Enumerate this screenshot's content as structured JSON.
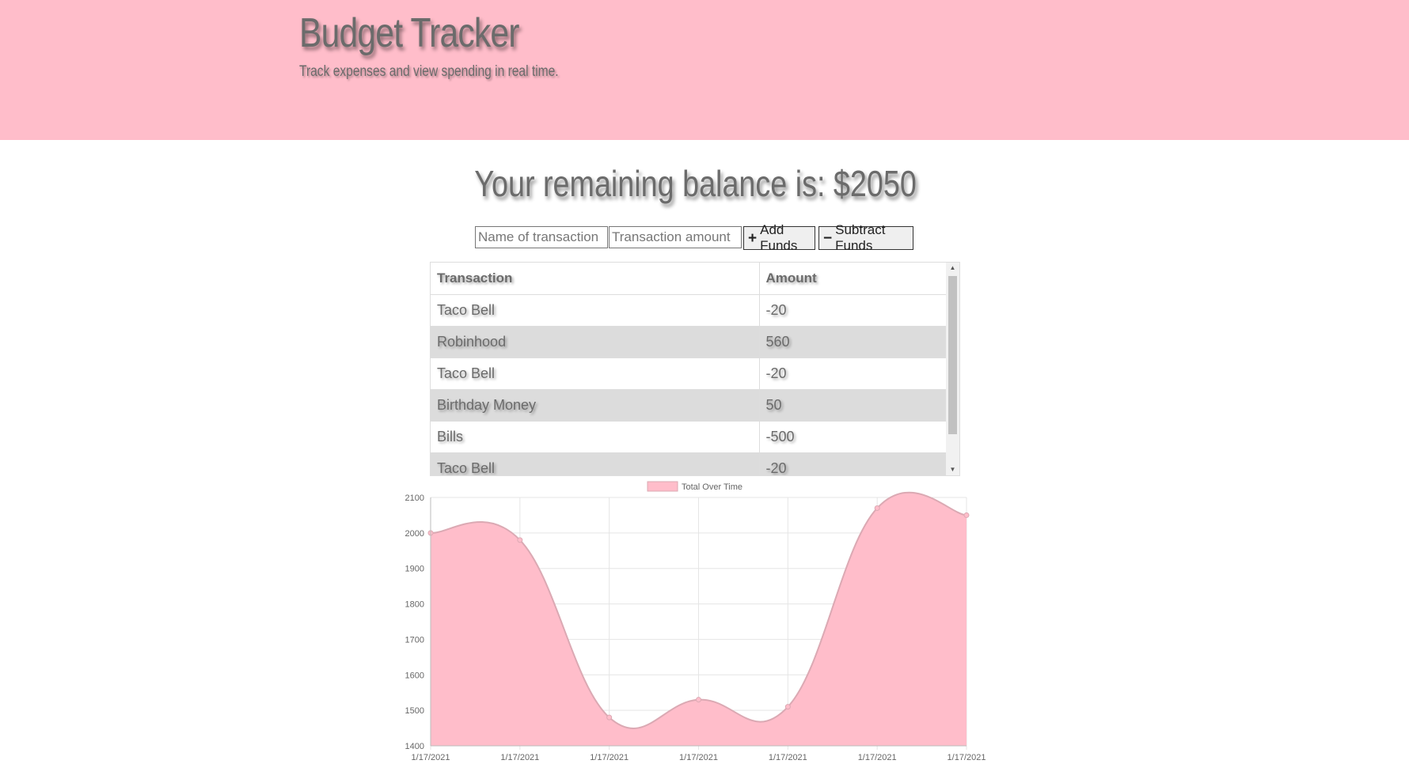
{
  "header": {
    "title": "Budget Tracker",
    "subtitle": "Track expenses and view spending in real time."
  },
  "balance": {
    "text": "Your remaining balance is: $2050"
  },
  "form": {
    "name_placeholder": "Name of transaction",
    "amount_placeholder": "Transaction amount",
    "add_label": "Add Funds",
    "add_icon": "plus-icon",
    "subtract_label": "Subtract Funds",
    "subtract_icon": "minus-icon"
  },
  "table": {
    "headers": [
      "Transaction",
      "Amount"
    ],
    "rows": [
      {
        "name": "Taco Bell",
        "amount": "-20"
      },
      {
        "name": "Robinhood",
        "amount": "560"
      },
      {
        "name": "Taco Bell",
        "amount": "-20"
      },
      {
        "name": "Birthday Money",
        "amount": "50"
      },
      {
        "name": "Bills",
        "amount": "-500"
      },
      {
        "name": "Taco Bell",
        "amount": "-20"
      }
    ]
  },
  "colors": {
    "header_bg": "#ffbdca",
    "chart_fill": "#ffbdca",
    "chart_line": "#dba9b3",
    "row_alt": "#dcdcdc"
  },
  "chart_data": {
    "type": "area",
    "legend": "top",
    "grid": true,
    "x": [
      "1/17/2021",
      "1/17/2021",
      "1/17/2021",
      "1/17/2021",
      "1/17/2021",
      "1/17/2021",
      "1/17/2021"
    ],
    "series": [
      {
        "name": "Total Over Time",
        "values": [
          2000,
          1980,
          1480,
          1530,
          1510,
          2070,
          2050
        ]
      }
    ],
    "ylim": [
      1400,
      2100
    ],
    "yticks": [
      1400,
      1500,
      1600,
      1700,
      1800,
      1900,
      2000,
      2100
    ]
  }
}
